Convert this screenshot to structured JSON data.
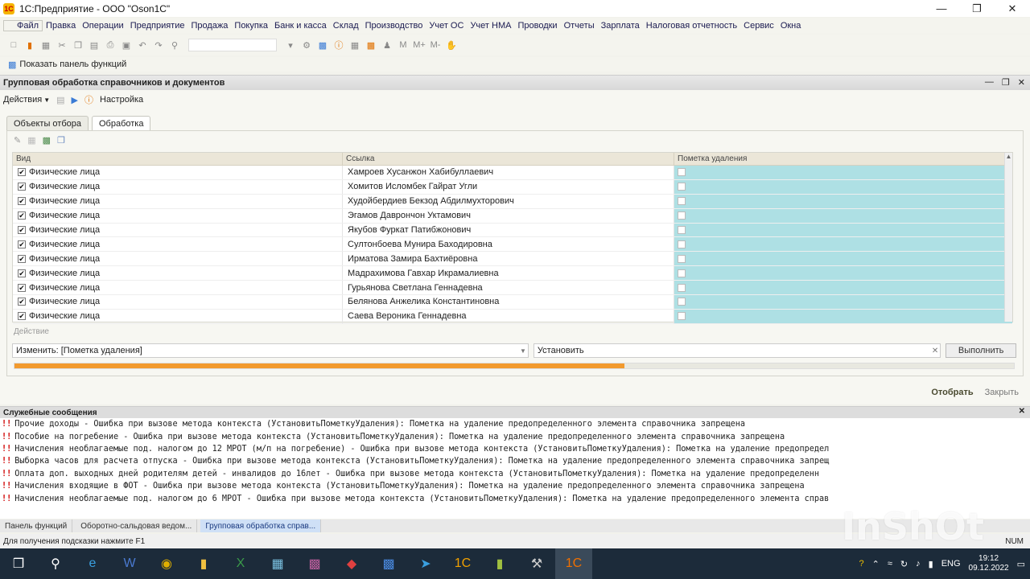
{
  "window": {
    "title": "1С:Предприятие - ООО \"Oson1C\""
  },
  "menu": [
    "Файл",
    "Правка",
    "Операции",
    "Предприятие",
    "Продажа",
    "Покупка",
    "Банк и касса",
    "Склад",
    "Производство",
    "Учет ОС",
    "Учет НМА",
    "Проводки",
    "Отчеты",
    "Зарплата",
    "Налоговая отчетность",
    "Сервис",
    "Окна"
  ],
  "funcbar": {
    "label": "Показать панель функций"
  },
  "processing": {
    "title": "Групповая обработка справочников и документов",
    "actions_label": "Действия",
    "settings_label": "Настройка",
    "tabs": [
      "Объекты отбора",
      "Обработка"
    ],
    "columns": [
      "Вид",
      "Ссылка",
      "Пометка удаления"
    ],
    "rows": [
      {
        "kind": "Физические лица",
        "ref": "Хамроев Хусанжон  Хабибуллаевич"
      },
      {
        "kind": "Физические лица",
        "ref": "Хомитов Исломбек Гайрат Угли"
      },
      {
        "kind": "Физические лица",
        "ref": "Худойбердиев Бекзод Абдилмухторович"
      },
      {
        "kind": "Физические лица",
        "ref": "Эгамов Даврончон  Уктамович"
      },
      {
        "kind": "Физические лица",
        "ref": "Якубов Фуркат Патибжонович"
      },
      {
        "kind": "Физические лица",
        "ref": "Султонбоева Мунира Баходировна"
      },
      {
        "kind": "Физические лица",
        "ref": "Ирматова Замира Бахтиёровна"
      },
      {
        "kind": "Физические лица",
        "ref": "Мадрахимова Гавхар Икрамалиевна"
      },
      {
        "kind": "Физические лица",
        "ref": "Гурьянова Светлана Геннадевна"
      },
      {
        "kind": "Физические лица",
        "ref": "Белянова Анжелика Константиновна"
      },
      {
        "kind": "Физические лица",
        "ref": "Саева Вероника Геннадевна"
      }
    ],
    "action_label": "Действие",
    "action_field": "Изменить: [Пометка удаления]",
    "value_field": "Установить",
    "execute_label": "Выполнить",
    "progress": 0.61,
    "select_label": "Отобрать",
    "close_label": "Закрыть"
  },
  "messages": {
    "title": "Служебные сообщения",
    "items": [
      "Прочие доходы -  Ошибка при вызове метода контекста (УстановитьПометкуУдаления): Пометка на удаление предопределенного элемента справочника запрещена",
      "Пособие на погребение -  Ошибка при вызове метода контекста (УстановитьПометкуУдаления): Пометка на удаление предопределенного элемента справочника запрещена",
      "Начисления необлагаемые под. налогом до 12 МРОТ (м/п на погребение) -  Ошибка при вызове метода контекста (УстановитьПометкуУдаления): Пометка на удаление предопредел",
      "Выборка часов для расчета отпуска -  Ошибка при вызове метода контекста (УстановитьПометкуУдаления): Пометка на удаление предопределенного элемента справочника запрещ",
      "Оплата доп. выходных дней родителям детей - инвалидов до 16лет -  Ошибка при вызове метода контекста (УстановитьПометкуУдаления): Пометка на удаление предопределенн",
      "Начисления входящие в ФОТ -  Ошибка при вызове метода контекста (УстановитьПометкуУдаления): Пометка на удаление предопределенного элемента справочника запрещена",
      "Начисления необлагаемые под. налогом до 6 МРОТ -  Ошибка при вызове метода контекста (УстановитьПометкуУдаления): Пометка на удаление предопределенного элемента справ"
    ]
  },
  "window_tabs": [
    "Панель функций",
    "Оборотно-сальдовая ведом...",
    "Групповая обработка справ..."
  ],
  "status": {
    "hint": "Для получения подсказки нажмите F1",
    "num": "NUM"
  },
  "watermark": "InShOt",
  "taskbar": {
    "lang": "ENG",
    "time": "19:12",
    "date": "09.12.2022"
  }
}
